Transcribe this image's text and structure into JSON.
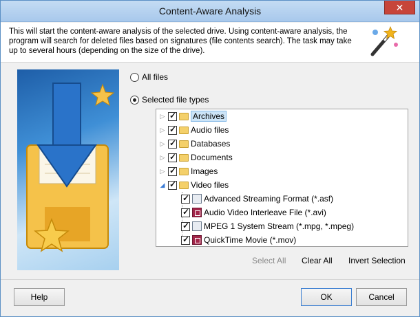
{
  "window": {
    "title": "Content-Aware Analysis",
    "close_glyph": "✕"
  },
  "header": {
    "description": "This will start the content-aware analysis of the selected drive. Using content-aware analysis, the program will search for deleted files based on signatures (file contents search). The task may take up to several hours (depending on the size of the drive).",
    "icon": "magic-wand-icon"
  },
  "options": {
    "all_files_label": "All files",
    "selected_types_label": "Selected file types",
    "selected": "selected_types"
  },
  "tree": {
    "categories": [
      {
        "label": "Archives",
        "checked": true,
        "expanded": false,
        "selected": true
      },
      {
        "label": "Audio files",
        "checked": true,
        "expanded": false
      },
      {
        "label": "Databases",
        "checked": true,
        "expanded": false
      },
      {
        "label": "Documents",
        "checked": true,
        "expanded": false
      },
      {
        "label": "Images",
        "checked": true,
        "expanded": false
      },
      {
        "label": "Video files",
        "checked": true,
        "expanded": true
      }
    ],
    "video_children": [
      {
        "label": "Advanced Streaming Format (*.asf)",
        "checked": true,
        "icon": "document-icon"
      },
      {
        "label": "Audio Video Interleave File (*.avi)",
        "checked": true,
        "icon": "media-icon"
      },
      {
        "label": "MPEG 1 System Stream (*.mpg, *.mpeg)",
        "checked": true,
        "icon": "document-icon"
      },
      {
        "label": "QuickTime Movie (*.mov)",
        "checked": true,
        "icon": "media-icon"
      }
    ]
  },
  "actions": {
    "select_all": "Select All",
    "clear_all": "Clear All",
    "invert_selection": "Invert Selection"
  },
  "footer": {
    "help": "Help",
    "ok": "OK",
    "cancel": "Cancel"
  },
  "colors": {
    "accent": "#3c7fd1",
    "close": "#c7453a",
    "folder": "#f4d06a"
  }
}
